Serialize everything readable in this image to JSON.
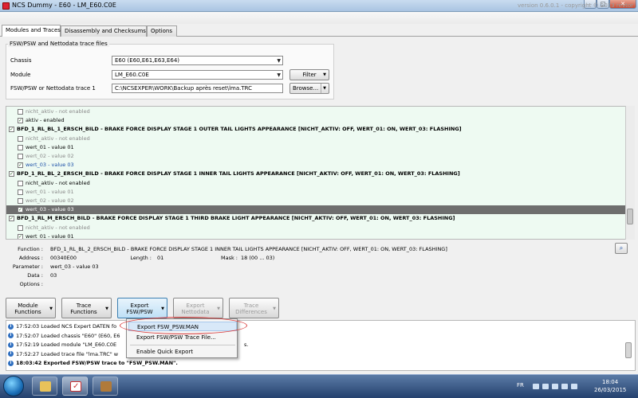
{
  "window": {
    "title": "NCS Dummy - E60 - LM_E60.C0E",
    "version": "version 0.6.0.1 - copyright © 2013 revtor"
  },
  "tabs": [
    "Modules and Traces",
    "Disassembly and Checksums",
    "Options"
  ],
  "group": {
    "title": "FSW/PSW and Nettodata trace files",
    "chassis_label": "Chassis",
    "chassis_value": "E60  (E60,E61,E63,E64)",
    "module_label": "Module",
    "module_value": "LM_E60.C0E",
    "filter_label": "Filter",
    "trace_label": "FSW/PSW or Nettodata trace 1",
    "trace_value": "C:\\NCSEXPER\\WORK\\Backup après reset\\lma.TRC",
    "browse_label": "Browse..."
  },
  "tree": [
    {
      "cb": false,
      "text": "nicht_aktiv  -  not enabled",
      "indent": 1,
      "style": "grey"
    },
    {
      "cb": true,
      "text": "aktiv  -  enabled",
      "indent": 1,
      "style": ""
    },
    {
      "cb": true,
      "text": "BFD_1_RL_BL_1_ERSCH_BILD  -  BRAKE FORCE DISPLAY STAGE 1 OUTER TAIL LIGHTS APPEARANCE [NICHT_AKTIV: OFF, WERT_01: ON, WERT_03: FLASHING]",
      "indent": 0,
      "style": "bold"
    },
    {
      "cb": false,
      "text": "nicht_aktiv  -  not enabled",
      "indent": 1,
      "style": "grey"
    },
    {
      "cb": false,
      "text": "wert_01  -  value 01",
      "indent": 1,
      "style": ""
    },
    {
      "cb": false,
      "text": "wert_02  -  value 02",
      "indent": 1,
      "style": "grey"
    },
    {
      "cb": true,
      "text": "wert_03  -  value 03",
      "indent": 1,
      "style": "blue"
    },
    {
      "cb": true,
      "text": "BFD_1_RL_BL_2_ERSCH_BILD  -  BRAKE FORCE DISPLAY STAGE 1 INNER TAIL LIGHTS APPEARANCE [NICHT_AKTIV: OFF, WERT_01: ON, WERT_03: FLASHING]",
      "indent": 0,
      "style": "bold"
    },
    {
      "cb": false,
      "text": "nicht_aktiv  -  not enabled",
      "indent": 1,
      "style": ""
    },
    {
      "cb": false,
      "text": "wert_01  -  value 01",
      "indent": 1,
      "style": "grey"
    },
    {
      "cb": false,
      "text": "wert_02  -  value 02",
      "indent": 1,
      "style": "grey"
    },
    {
      "cb": true,
      "text": "wert_03  -  value 03",
      "indent": 1,
      "style": "sel"
    },
    {
      "cb": true,
      "text": "BFD_1_RL_M_ERSCH_BILD  -  BRAKE FORCE DISPLAY STAGE 1 THIRD BRAKE LIGHT APPEARANCE [NICHT_AKTIV: OFF, WERT_01: ON, WERT_03: FLASHING]",
      "indent": 0,
      "style": "bold"
    },
    {
      "cb": false,
      "text": "nicht_aktiv  -  not enabled",
      "indent": 1,
      "style": "grey"
    },
    {
      "cb": true,
      "text": "wert_01  -  value 01",
      "indent": 1,
      "style": ""
    }
  ],
  "details": {
    "function_label": "Function :",
    "function_value": "BFD_1_RL_BL_2_ERSCH_BILD  -  BRAKE FORCE DISPLAY STAGE 1 INNER TAIL LIGHTS APPEARANCE [NICHT_AKTIV: OFF, WERT_01: ON, WERT_03: FLASHING]",
    "address_label": "Address :",
    "address_value": "00340E00",
    "length_label": "Length :",
    "length_value": "01",
    "mask_label": "Mask :",
    "mask_value": "18  (00 ... 03)",
    "parameter_label": "Parameter :",
    "parameter_value": "wert_03  -  value 03",
    "data_label": "Data :",
    "data_value": "03",
    "options_label": "Options :"
  },
  "toolbar": [
    {
      "line1": "Module",
      "line2": "Functions",
      "state": "normal"
    },
    {
      "line1": "Trace",
      "line2": "Functions",
      "state": "normal"
    },
    {
      "line1": "Export",
      "line2": "FSW/PSW",
      "state": "active"
    },
    {
      "line1": "Export",
      "line2": "Nettodata",
      "state": "disabled"
    },
    {
      "line1": "Trace",
      "line2": "Differences",
      "state": "disabled"
    }
  ],
  "log": [
    {
      "text": "17:52:03  Loaded NCS Expert DATEN fo",
      "bold": false
    },
    {
      "text": "17:52:07  Loaded chassis \"E60\" (E60, E6",
      "bold": false
    },
    {
      "text": "17:52:19  Loaded module \"LM_E60.C0E",
      "bold": false,
      "tail": "s."
    },
    {
      "text": "17:52:27  Loaded trace file \"lma.TRC\" w",
      "bold": false
    },
    {
      "text": "18:03:42  Exported FSW/PSW trace to \"FSW_PSW.MAN\".",
      "bold": true
    }
  ],
  "menu": {
    "items": [
      "Export FSW_PSW.MAN",
      "Export FSW/PSW Trace File...",
      "Enable Quick Export"
    ]
  },
  "taskbar": {
    "lang": "FR",
    "time": "18:04",
    "date": "26/03/2015"
  }
}
